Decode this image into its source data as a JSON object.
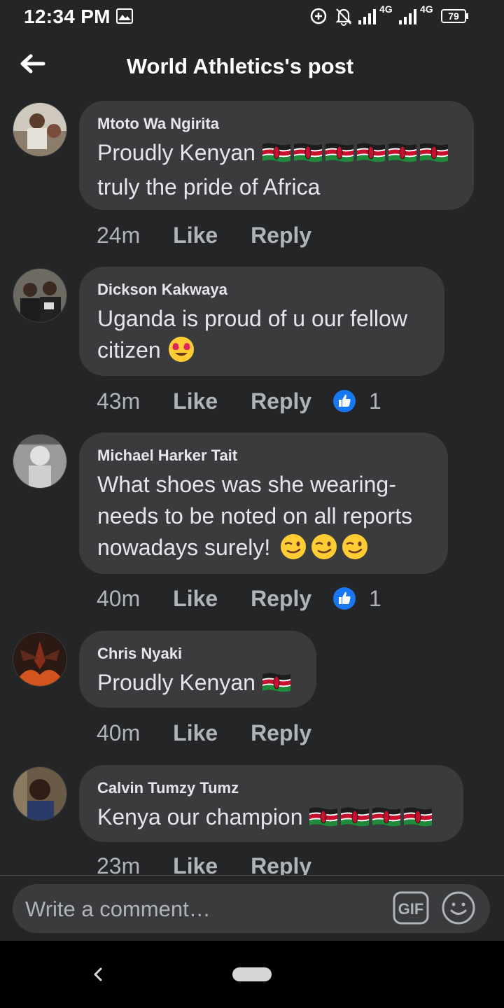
{
  "status_bar": {
    "time": "12:34 PM",
    "network_1": "4G",
    "network_2": "4G",
    "battery": "79"
  },
  "header": {
    "title": "World Athletics's post"
  },
  "comments": [
    {
      "author": "Mtoto Wa Ngirita",
      "line1": "Proudly Kenyan",
      "line2": "truly the pride of Africa",
      "line3": "",
      "flags": 6,
      "trailing_emoji": "",
      "time": "24m",
      "like": "Like",
      "reply": "Reply",
      "reaction_count": ""
    },
    {
      "author": "Dickson Kakwaya",
      "line1": "Uganda is proud of u our fellow",
      "line2": "citizen",
      "line3": "",
      "flags": 0,
      "trailing_emoji": "heart-eyes",
      "time": "43m",
      "like": "Like",
      "reply": "Reply",
      "reaction_count": "1"
    },
    {
      "author": "Michael Harker Tait",
      "line1": "What shoes was she wearing-",
      "line2": "needs to be noted on all reports",
      "line3": "nowadays surely!",
      "flags": 0,
      "trailing_emoji": "wink x3",
      "time": "40m",
      "like": "Like",
      "reply": "Reply",
      "reaction_count": "1"
    },
    {
      "author": "Chris Nyaki",
      "line1": "Proudly Kenyan",
      "line2": "",
      "line3": "",
      "flags": 1,
      "trailing_emoji": "",
      "time": "40m",
      "like": "Like",
      "reply": "Reply",
      "reaction_count": ""
    },
    {
      "author": "Calvin Tumzy Tumz",
      "line1": "Kenya our champion",
      "line2": "",
      "line3": "",
      "flags": 4,
      "trailing_emoji": "",
      "time": "23m",
      "like": "Like",
      "reply": "Reply",
      "reaction_count": ""
    }
  ],
  "composer": {
    "placeholder": "Write a comment…",
    "gif_label": "GIF"
  },
  "colors": {
    "background": "#242527",
    "bubble": "#3a3b3c",
    "text": "#e4e6eb",
    "secondary_text": "#b0b3b8",
    "like_blue": "#1877f2"
  }
}
